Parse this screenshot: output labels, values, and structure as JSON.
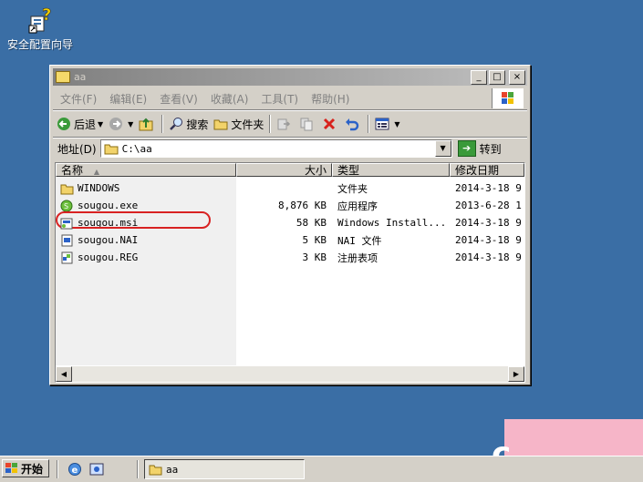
{
  "desktop": {
    "icon_label": "安全配置向导"
  },
  "window": {
    "title": "aa",
    "buttons": {
      "minimize": "_",
      "maximize": "□",
      "close": "×"
    },
    "menu": [
      "文件(F)",
      "编辑(E)",
      "查看(V)",
      "收藏(A)",
      "工具(T)",
      "帮助(H)"
    ],
    "toolbar": {
      "back": "后退",
      "search": "搜索",
      "folders": "文件夹"
    },
    "address": {
      "label": "地址(D)",
      "value": "C:\\aa",
      "go": "转到"
    },
    "columns": [
      "名称",
      "大小",
      "类型",
      "修改日期"
    ],
    "files": [
      {
        "name": "WINDOWS",
        "size": "",
        "type": "文件夹",
        "date": "2014-3-18 9",
        "icon": "folder-icon"
      },
      {
        "name": "sougou.exe",
        "size": "8,876 KB",
        "type": "应用程序",
        "date": "2013-6-28 1",
        "icon": "exe-icon"
      },
      {
        "name": "sougou.msi",
        "size": "58 KB",
        "type": "Windows Install...",
        "date": "2014-3-18 9",
        "icon": "msi-icon",
        "highlighted": true
      },
      {
        "name": "sougou.NAI",
        "size": "5 KB",
        "type": "NAI 文件",
        "date": "2014-3-18 9",
        "icon": "nai-icon"
      },
      {
        "name": "sougou.REG",
        "size": "3 KB",
        "type": "注册表项",
        "date": "2014-3-18 9",
        "icon": "reg-icon"
      }
    ]
  },
  "taskbar": {
    "start": "开始",
    "task_title": "aa"
  },
  "colors": {
    "desktop": "#3a6ea5",
    "highlight_circle": "#d82222",
    "face": "#d4d0c8"
  }
}
